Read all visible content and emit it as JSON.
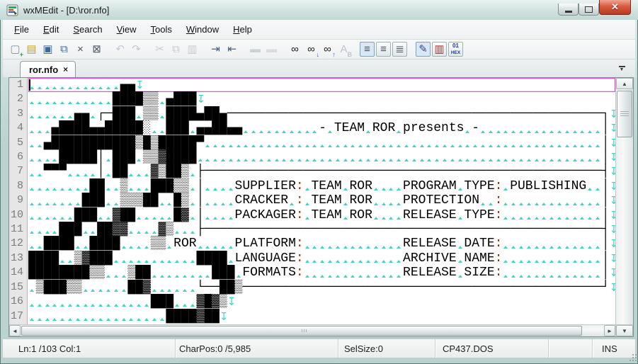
{
  "window": {
    "title": "wxMEdit - [D:\\ror.nfo]"
  },
  "window_controls": {
    "minimize": "minimize",
    "maximize": "maximize",
    "close": "✕"
  },
  "menu": {
    "items": [
      "File",
      "Edit",
      "Search",
      "View",
      "Tools",
      "Window",
      "Help"
    ]
  },
  "toolbar": {
    "icons": [
      {
        "name": "new-file-icon",
        "glyph": "▢",
        "color": "#7e93a0",
        "overlay": "+",
        "ocolor": "#2f9e44"
      },
      {
        "name": "open-file-icon",
        "glyph": "▤",
        "color": "#c9a227"
      },
      {
        "name": "save-file-icon",
        "glyph": "▣",
        "color": "#39699f"
      },
      {
        "name": "save-all-icon",
        "glyph": "⧉",
        "color": "#39699f"
      },
      {
        "name": "close-file-icon",
        "glyph": "×",
        "color": "#4e585f"
      },
      {
        "name": "close-all-icon",
        "glyph": "⊠",
        "color": "#4e585f"
      },
      {
        "name": "undo-icon",
        "glyph": "↶",
        "color": "#8f9fb3",
        "disabled": true,
        "gap": true
      },
      {
        "name": "redo-icon",
        "glyph": "↷",
        "color": "#8f9fb3",
        "disabled": true
      },
      {
        "name": "cut-icon",
        "glyph": "✂",
        "color": "#9aa2ad",
        "disabled": true,
        "gap": true
      },
      {
        "name": "copy-icon",
        "glyph": "⧉",
        "color": "#9aa2ad",
        "disabled": true
      },
      {
        "name": "paste-icon",
        "glyph": "▥",
        "color": "#9aa2ad",
        "disabled": true
      },
      {
        "name": "indent-icon",
        "glyph": "⇥",
        "color": "#44617e",
        "gap": true
      },
      {
        "name": "unindent-icon",
        "glyph": "⇤",
        "color": "#44617e"
      },
      {
        "name": "comment-icon",
        "glyph": "▬",
        "color": "#aab0b6",
        "disabled": true,
        "gap": true
      },
      {
        "name": "uncomment-icon",
        "glyph": "▬",
        "color": "#c0c6cc",
        "disabled": true
      },
      {
        "name": "find-icon",
        "glyph": "∞",
        "color": "#1d1d1d",
        "gap": true
      },
      {
        "name": "find-next-icon",
        "glyph": "∞",
        "color": "#1d1d1d",
        "overlay": "↓",
        "ocolor": "#2b4fd8"
      },
      {
        "name": "find-previous-icon",
        "glyph": "∞",
        "color": "#1d1d1d",
        "overlay": "↑",
        "ocolor": "#2b4fd8"
      },
      {
        "name": "replace-icon",
        "glyph": "A",
        "color": "#8d95a0",
        "overlay": "B",
        "ocolor": "#8d95a0",
        "disabled": true
      },
      {
        "name": "wrap-none-icon",
        "glyph": "≡",
        "color": "#44525e",
        "framed": true,
        "active": true,
        "gap": true
      },
      {
        "name": "wrap-by-window-icon",
        "glyph": "≡",
        "color": "#44525e",
        "framed": true
      },
      {
        "name": "wrap-by-column-icon",
        "glyph": "≣",
        "color": "#44525e",
        "framed": true
      },
      {
        "name": "text-mode-icon",
        "glyph": "✎",
        "color": "#34488c",
        "framed": true,
        "active": true,
        "gap": true
      },
      {
        "name": "column-mode-icon",
        "glyph": "▥",
        "color": "#b03030",
        "framed": true
      },
      {
        "name": "hex-mode-icon",
        "glyph": "01",
        "color": "#2233bb",
        "overlay": "HEX",
        "ocolor": "#2233bb",
        "framed": true,
        "small": true
      }
    ]
  },
  "tabbar": {
    "tabs": [
      {
        "label": "ror.nfo",
        "close": "×"
      }
    ],
    "tablist_glyph": "▼"
  },
  "editor": {
    "gutter": [
      "1",
      "2",
      "3",
      "4",
      "5",
      "6",
      "7",
      "8",
      "9",
      "10",
      "11",
      "12",
      "13",
      "14",
      "15",
      "16",
      "17"
    ],
    "current_line": 1,
    "newline_glyph": "↧",
    "colors": {
      "space_marker": "#3fd4c6",
      "newline_marker": "#3fd4c6",
      "current_line_border": "#e254d2",
      "punctuation": "#943400"
    },
    "lines": [
      "            ▄▄",
      "           ████▒▒ ▄███",
      "      ▄▄ ┌─███ ▒▒ ████▄██▄─────────────────────────────────────────────────┐",
      "   ▄████▄▄█████░  ███ ▄▄██▄▄          - TEAM ROR presents -                │",
      "  ▄███████████▒█▒█████▀                                                    │",
      "    █████│ ███ ▒▒▓████                                                     │",
      "  ▀▀▀    │ ██   ▓▒██▒ ├────────────────────────────────────────────────────┤",
      "        ██  ▒   ███▒▒ │    SUPPLIER: TEAM ROR    PROGRAM TYPE: PUBLISHING  │",
      "       ███  ▒▒▒██  █▒ │    CRACKER : TEAM ROR    PROTECTION  :             │",
      "      ███  ▓██     █▓ │    PACKAGER: TEAM ROR    RELEASE TYPE:             │",
      "    ███  ██▓▓    ▓▒   ├────────────────────────────────────────────────────┤",
      "  ████  ████    ▒▒ ROR     PLATFORM:             RELEASE DATE:             │",
      "████  ▒▓███           ████ LANGUAGE:             ARCHIVE NAME:             │",
      "████████▒▒   ▒██        ███ FORMATS:             RELEASE SIZE:             │",
      " ▒███▒▒      ██▓      └──██▒───────────────────────────────────────────────┘",
      "                ███   ▓█▓▒",
      "                  ████▓██"
    ]
  },
  "scrollbars": {
    "up": "▲",
    "down": "▼",
    "left": "◄",
    "right": "►"
  },
  "statusbar": {
    "sections": [
      {
        "label": "Ln:1 /103 Col:1"
      },
      {
        "label": "CharPos:0 /5,985"
      },
      {
        "label": "SelSize:0"
      },
      {
        "label": "CP437.DOS"
      },
      {
        "label": ""
      },
      {
        "label": "INS"
      }
    ]
  }
}
